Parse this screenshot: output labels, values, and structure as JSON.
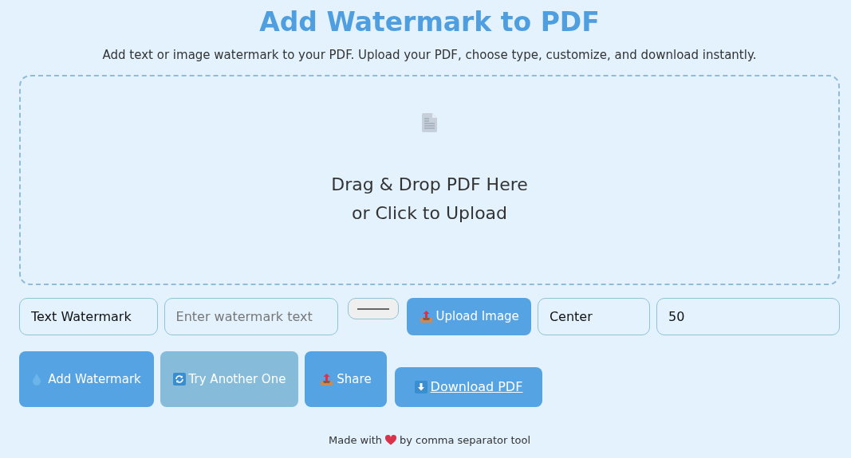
{
  "title": "Add Watermark to PDF",
  "subtitle": "Add text or image watermark to your PDF. Upload your PDF, choose type, customize, and download instantly.",
  "dropzone": {
    "lines": [
      "Drag & Drop PDF Here",
      "or Click to Upload"
    ]
  },
  "controls": {
    "type_select": "Text Watermark",
    "text_field": {
      "placeholder": "Enter watermark text"
    },
    "upload_button": "Upload Image",
    "position_select": "Center",
    "size_field": "50"
  },
  "actions": [
    {
      "kind": "add",
      "label": "Add Watermark"
    },
    {
      "kind": "reset",
      "label": "Try Another One"
    },
    {
      "kind": "share",
      "label": "Share"
    },
    {
      "kind": "download",
      "label": "Download PDF"
    }
  ],
  "footer": {
    "before": "Made with",
    "middle": "by",
    "link": "comma separator tool"
  }
}
